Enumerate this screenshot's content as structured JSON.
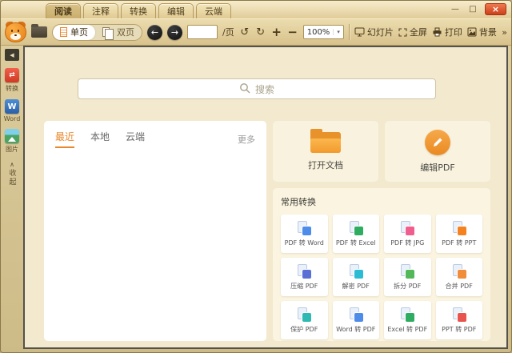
{
  "titlebar": {
    "tabs": [
      {
        "label": "阅读"
      },
      {
        "label": "注释"
      },
      {
        "label": "转换"
      },
      {
        "label": "编辑"
      },
      {
        "label": "云端"
      }
    ],
    "window_controls": {
      "minimize": "—",
      "maximize": "□",
      "close": "×"
    }
  },
  "toolbar": {
    "page_mode": {
      "single_label": "单页",
      "double_label": "双页"
    },
    "page_input": {
      "value": "",
      "suffix": "/页"
    },
    "glyphs": {
      "back": "←",
      "forward": "→",
      "undo": "↺",
      "redo": "↻",
      "zoom_in": "+",
      "zoom_out": "−",
      "caret": "▾",
      "overflow": "»"
    },
    "zoom_value": "100%",
    "slideshow_label": "幻灯片",
    "fullscreen_label": "全屏",
    "print_label": "打印",
    "background_label": "背景"
  },
  "sidebar": {
    "collapse_glyph": "◀",
    "items": [
      {
        "label": "转换",
        "glyph": "⇄"
      },
      {
        "label": "Word",
        "glyph": "W"
      },
      {
        "label": "图片",
        "glyph": ""
      }
    ],
    "collapse": {
      "glyph": "∧",
      "label": "收起"
    }
  },
  "content": {
    "search": {
      "placeholder": "搜索"
    },
    "files_panel": {
      "tabs": [
        {
          "label": "最近"
        },
        {
          "label": "本地"
        },
        {
          "label": "云端"
        }
      ],
      "more_label": "更多"
    },
    "action_cards": [
      {
        "label": "打开文档",
        "icon": "folder-icon"
      },
      {
        "label": "编辑PDF",
        "icon": "pencil-icon"
      }
    ],
    "conversions": {
      "title": "常用转换",
      "items": [
        {
          "label": "PDF 转 Word",
          "color": "#4d8ce8"
        },
        {
          "label": "PDF 转 Excel",
          "color": "#2eac5f"
        },
        {
          "label": "PDF 转 JPG",
          "color": "#ef5e8c"
        },
        {
          "label": "PDF 转 PPT",
          "color": "#f58220"
        },
        {
          "label": "压缩 PDF",
          "color": "#5a6fd6"
        },
        {
          "label": "解密 PDF",
          "color": "#2bbcd4"
        },
        {
          "label": "拆分 PDF",
          "color": "#52b85a"
        },
        {
          "label": "合并 PDF",
          "color": "#f08c3a"
        },
        {
          "label": "保护 PDF",
          "color": "#30b8b2"
        },
        {
          "label": "Word 转 PDF",
          "color": "#4d8ce8"
        },
        {
          "label": "Excel 转 PDF",
          "color": "#2eac5f"
        },
        {
          "label": "PPT 转 PDF",
          "color": "#e8544d"
        }
      ]
    }
  }
}
